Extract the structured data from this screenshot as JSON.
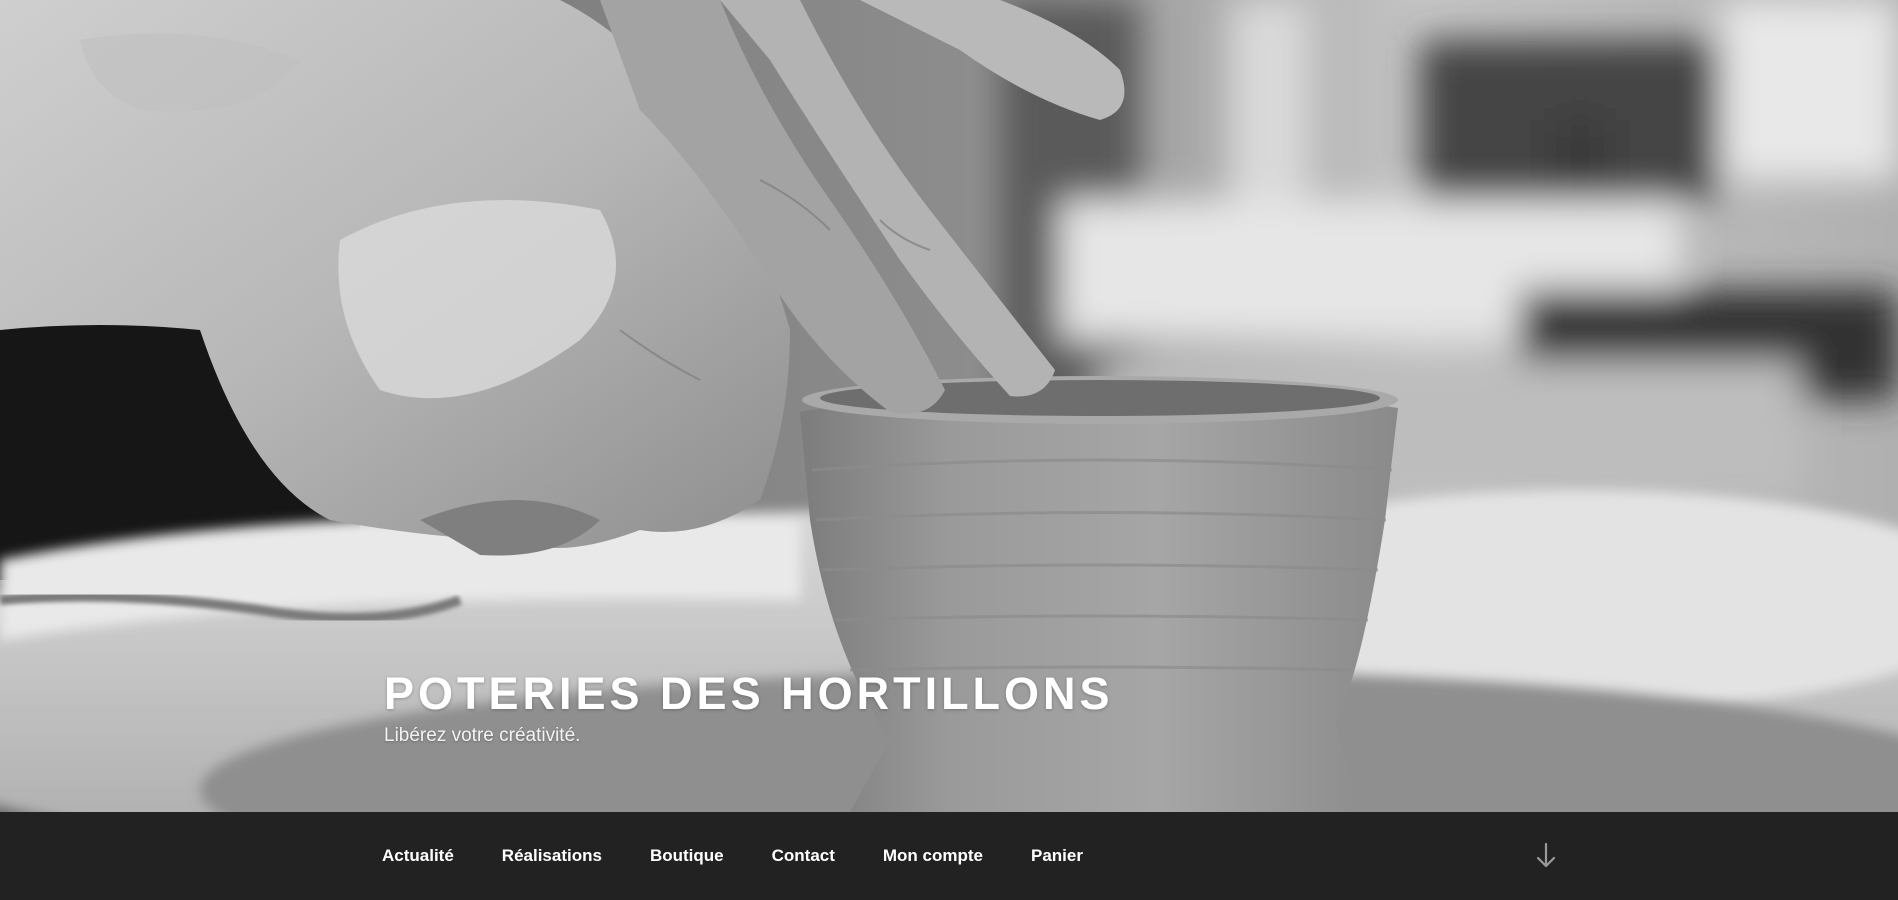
{
  "branding": {
    "site_title": "POTERIES DES HORTILLONS",
    "site_description": "Libérez votre créativité."
  },
  "hero": {
    "image_subject": "black and white photo of hands shaping a clay bowl on a pottery wheel"
  },
  "navigation": {
    "items": [
      {
        "label": "Actualité"
      },
      {
        "label": "Réalisations"
      },
      {
        "label": "Boutique"
      },
      {
        "label": "Contact"
      },
      {
        "label": "Mon compte"
      },
      {
        "label": "Panier"
      }
    ],
    "scroll_icon": "arrow-down-icon"
  },
  "colors": {
    "nav_background": "#222222",
    "nav_text": "#ffffff",
    "title_text": "#ffffff",
    "scroll_icon": "#9a9a9a"
  }
}
